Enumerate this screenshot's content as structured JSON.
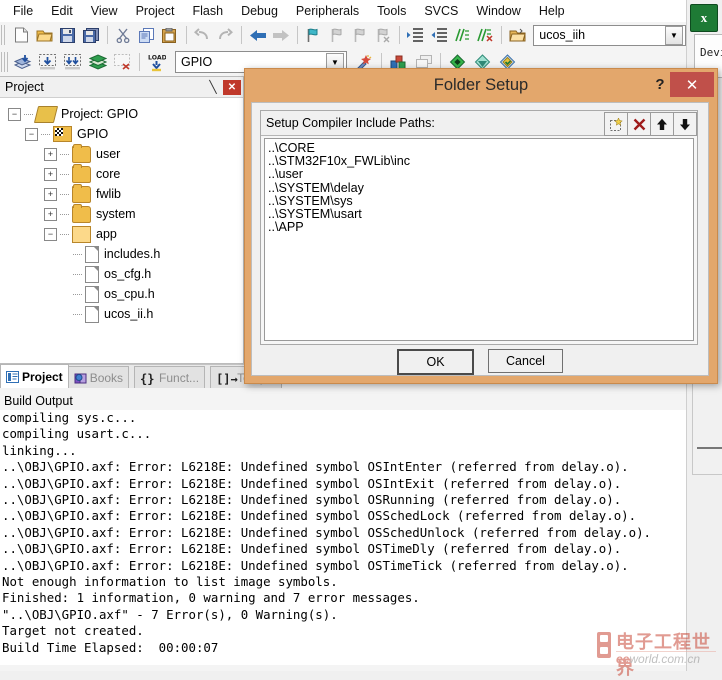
{
  "menu": {
    "items": [
      "File",
      "Edit",
      "View",
      "Project",
      "Flash",
      "Debug",
      "Peripherals",
      "Tools",
      "SVCS",
      "Window",
      "Help"
    ]
  },
  "toolbar_row1": {
    "buttons": [
      "new-file",
      "open-file",
      "save",
      "save-all",
      "cut",
      "copy",
      "paste",
      "undo",
      "redo",
      "navigate-back",
      "navigate-forward",
      "bookmark-toggle",
      "bookmark-prev",
      "bookmark-next",
      "bookmark-clear",
      "indent",
      "outdent",
      "comment",
      "uncomment"
    ],
    "open_file_label": "ucos_iih"
  },
  "toolbar_row2": {
    "buttons": [
      "build-file",
      "build-target",
      "rebuild-all",
      "batch-build",
      "stop-build",
      "load",
      "target-options",
      "configure-wizard",
      "manage-project-items",
      "multi-project",
      "book",
      "debug-start",
      "debug-settings"
    ],
    "target_label": "GPIO"
  },
  "project_panel": {
    "title": "Project",
    "pin_icon": "pin-icon",
    "close_icon": "close-icon",
    "tree": [
      {
        "label": "Project: GPIO",
        "level": 0,
        "icon": "project-icon",
        "toggle": "-"
      },
      {
        "label": "GPIO",
        "level": 1,
        "icon": "target-icon",
        "toggle": "-"
      },
      {
        "label": "user",
        "level": 2,
        "icon": "folder-icon",
        "toggle": "+"
      },
      {
        "label": "core",
        "level": 2,
        "icon": "folder-icon",
        "toggle": "+"
      },
      {
        "label": "fwlib",
        "level": 2,
        "icon": "folder-icon",
        "toggle": "+"
      },
      {
        "label": "system",
        "level": 2,
        "icon": "folder-icon",
        "toggle": "+"
      },
      {
        "label": "app",
        "level": 2,
        "icon": "folder-open-icon",
        "toggle": "-"
      },
      {
        "label": "includes.h",
        "level": 3,
        "icon": "file-icon",
        "toggle": ""
      },
      {
        "label": "os_cfg.h",
        "level": 3,
        "icon": "file-icon",
        "toggle": ""
      },
      {
        "label": "os_cpu.h",
        "level": 3,
        "icon": "file-icon",
        "toggle": ""
      },
      {
        "label": "ucos_ii.h",
        "level": 3,
        "icon": "file-icon",
        "toggle": ""
      }
    ]
  },
  "bottom_tabs": [
    {
      "label": "Project",
      "icon": "project-tab-icon",
      "active": true
    },
    {
      "label": "Books",
      "icon": "books-icon",
      "active": false
    },
    {
      "label": "Funct...",
      "icon": "functions-icon",
      "active": false
    },
    {
      "label": "Templ..",
      "icon": "templates-icon",
      "active": false
    }
  ],
  "build_output": {
    "title": "Build Output",
    "lines": [
      "compiling sys.c...",
      "compiling usart.c...",
      "linking...",
      "..\\OBJ\\GPIO.axf: Error: L6218E: Undefined symbol OSIntEnter (referred from delay.o).",
      "..\\OBJ\\GPIO.axf: Error: L6218E: Undefined symbol OSIntExit (referred from delay.o).",
      "..\\OBJ\\GPIO.axf: Error: L6218E: Undefined symbol OSRunning (referred from delay.o).",
      "..\\OBJ\\GPIO.axf: Error: L6218E: Undefined symbol OSSchedLock (referred from delay.o).",
      "..\\OBJ\\GPIO.axf: Error: L6218E: Undefined symbol OSSchedUnlock (referred from delay.o).",
      "..\\OBJ\\GPIO.axf: Error: L6218E: Undefined symbol OSTimeDly (referred from delay.o).",
      "..\\OBJ\\GPIO.axf: Error: L6218E: Undefined symbol OSTimeTick (referred from delay.o).",
      "Not enough information to list image symbols.",
      "Finished: 1 information, 0 warning and 7 error messages.",
      "\"..\\OBJ\\GPIO.axf\" - 7 Error(s), 0 Warning(s).",
      "Target not created.",
      "Build Time Elapsed:  00:00:07"
    ]
  },
  "dialog": {
    "title": "Folder Setup",
    "help_label": "?",
    "close_label": "✕",
    "group_label": "Setup Compiler Include Paths:",
    "group_buttons": [
      {
        "name": "new-path-button",
        "glyph": "⬚"
      },
      {
        "name": "delete-path-button",
        "glyph": "✕"
      },
      {
        "name": "move-up-button",
        "glyph": "⬆"
      },
      {
        "name": "move-down-button",
        "glyph": "⬇"
      }
    ],
    "paths": [
      "..\\CORE",
      "..\\STM32F10x_FWLib\\inc",
      "..\\user",
      "..\\SYSTEM\\delay",
      "..\\SYSTEM\\sys",
      "..\\SYSTEM\\usart",
      "..\\APP"
    ],
    "ok_label": "OK",
    "cancel_label": "Cancel"
  },
  "right_pane": {
    "app_icon": "keil-uvision-icon",
    "device_label": "Devi"
  },
  "watermark": {
    "cn_text": "电子工程世界",
    "en_prefix": "ee",
    "en_suffix": "world.com.cn"
  },
  "colors": {
    "dialog_frame": "#e3a76c",
    "close_button": "#c0504a",
    "accent": "#2b5797"
  }
}
